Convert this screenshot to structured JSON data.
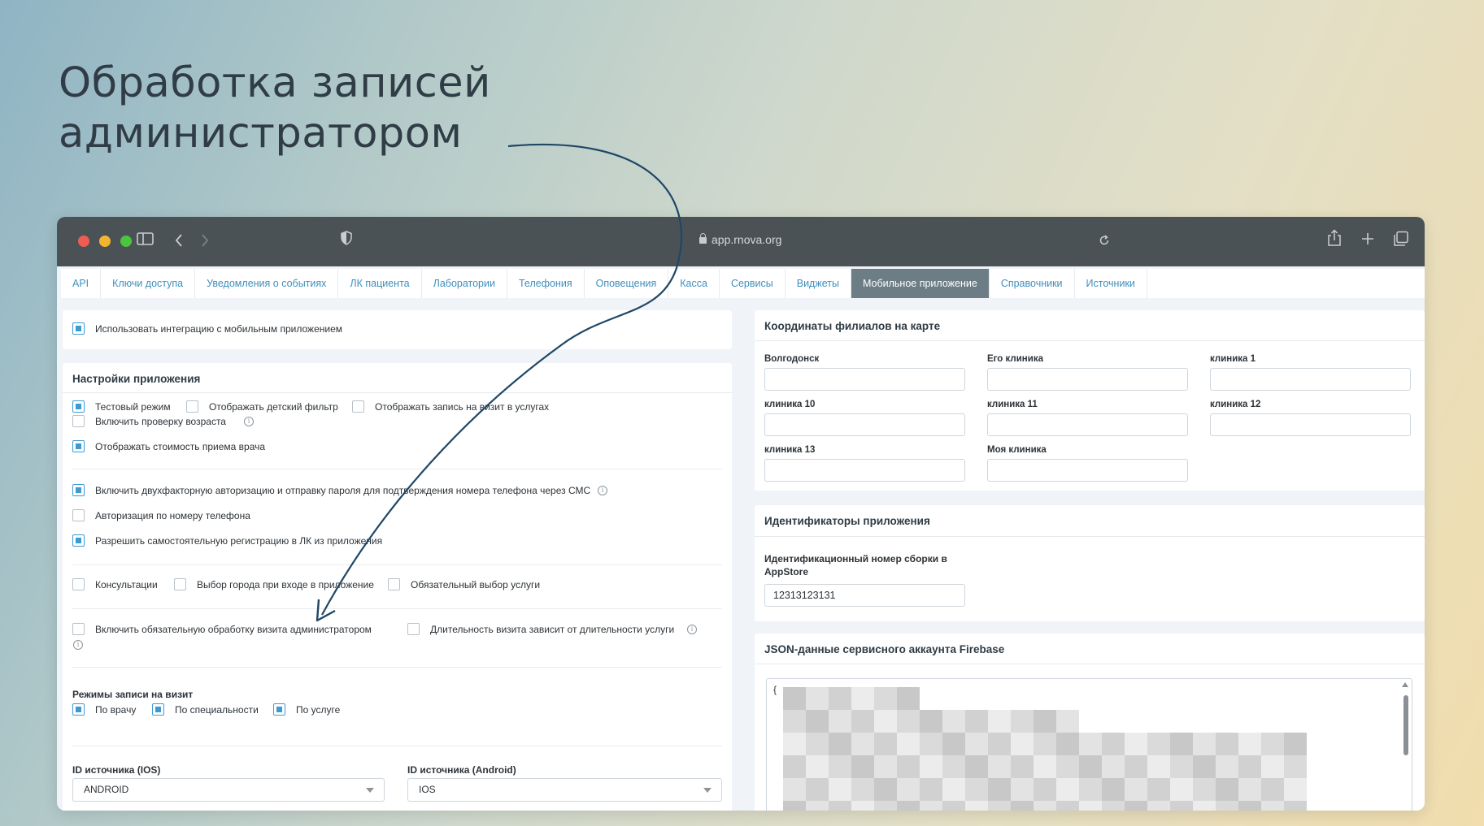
{
  "headline": {
    "line1": "Обработка записей",
    "line2": "администратором"
  },
  "browser": {
    "url": "app.rnova.org"
  },
  "tabs": [
    "API",
    "Ключи доступа",
    "Уведомления о событиях",
    "ЛК пациента",
    "Лаборатории",
    "Телефония",
    "Оповещения",
    "Касса",
    "Сервисы",
    "Виджеты",
    "Мобильное приложение",
    "Справочники",
    "Источники"
  ],
  "active_tab": "Мобильное приложение",
  "integration": {
    "label": "Использовать интеграцию с мобильным приложением",
    "checked": true
  },
  "app_settings": {
    "title": "Настройки приложения",
    "test_mode": "Тестовый режим",
    "kids_filter": "Отображать детский фильтр",
    "show_booking": "Отображать запись на визит в услугах",
    "age_check": "Включить проверку возраста",
    "show_price": "Отображать стоимость приема врача",
    "two_factor": "Включить двухфакторную авторизацию и отправку пароля для подтверждения номера телефона через СМС",
    "phone_auth": "Авторизация по номеру телефона",
    "self_register": "Разрешить самостоятельную регистрацию в ЛК из приложения",
    "consultations": "Консультации",
    "city_select": "Выбор города при входе в приложение",
    "service_required": "Обязательный выбор услуги",
    "admin_processing": "Включить обязательную обработку визита администратором",
    "duration_depends": "Длительность визита зависит от длительности услуги",
    "booking_modes_title": "Режимы записи на визит",
    "by_doctor": "По врачу",
    "by_specialty": "По специальности",
    "by_service": "По услуге",
    "ios_source_label": "ID источника (IOS)",
    "ios_source_value": "ANDROID",
    "android_source_label": "ID источника (Android)",
    "android_source_value": "IOS",
    "info_glyph": "i"
  },
  "branches": {
    "title": "Координаты филиалов на карте",
    "items": [
      "Волгодонск",
      "Его клиника",
      "клиника 1",
      "клиника 10",
      "клиника 11",
      "клиника 12",
      "клиника 13",
      "Моя клиника"
    ]
  },
  "app_ids": {
    "title": "Идентификаторы приложения",
    "appstore_label": "Идентификационный номер сборки в AppStore",
    "appstore_value": "12313123131"
  },
  "firebase": {
    "title": "JSON-данные сервисного аккаунта Firebase",
    "open_brace": "{"
  },
  "colors": {
    "accent": "#3d9bd1",
    "tab_active_bg": "#6c7d86",
    "titlebar": "#4b5255",
    "arrow": "#1f4766"
  }
}
